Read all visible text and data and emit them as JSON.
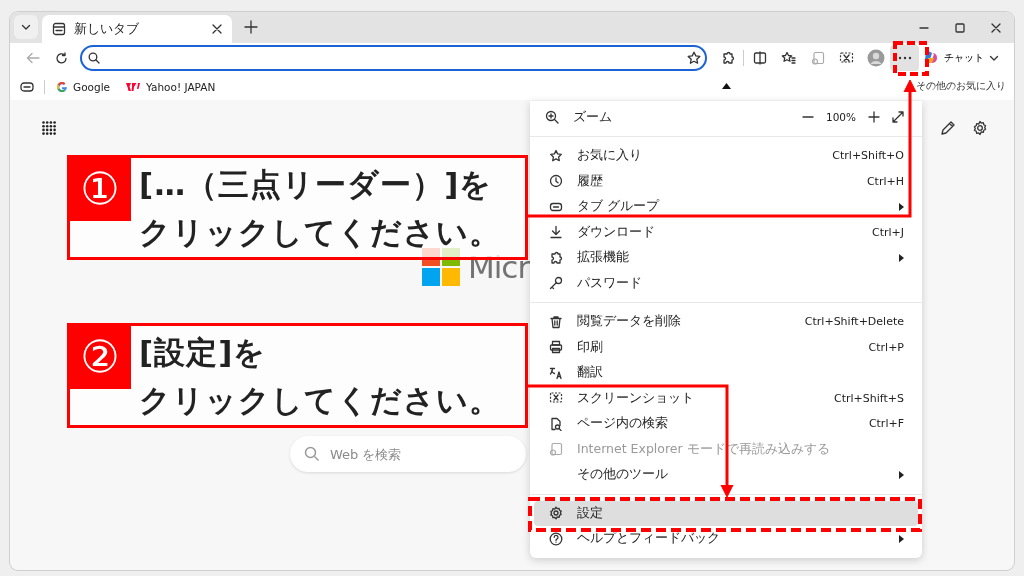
{
  "tab_strip": {
    "tabs": [
      {
        "title": "新しいタブ",
        "selected": true
      }
    ]
  },
  "toolbar": {
    "chat_label": "チャット"
  },
  "bookmarks_bar": {
    "items": [
      {
        "label": "Google",
        "kind": "google"
      },
      {
        "label": "Yahoo! JAPAN",
        "kind": "yahoo"
      }
    ],
    "other_favorites": "その他のお気に入り"
  },
  "new_tab_page": {
    "logo_text": "Micr",
    "search_placeholder": "Web を検索"
  },
  "menu": {
    "zoom": {
      "label": "ズーム",
      "value": "100%"
    },
    "sections": [
      {
        "items": [
          {
            "label": "お気に入り",
            "shortcut": "Ctrl+Shift+O",
            "submenu": false,
            "disabled": false,
            "selected": false
          },
          {
            "label": "履歴",
            "shortcut": "Ctrl+H",
            "submenu": false,
            "disabled": false,
            "selected": false
          },
          {
            "label": "タブ グループ",
            "submenu": true,
            "disabled": false,
            "selected": false
          },
          {
            "label": "ダウンロード",
            "shortcut": "Ctrl+J",
            "submenu": false,
            "disabled": false,
            "selected": false
          },
          {
            "label": "拡張機能",
            "submenu": true,
            "disabled": false,
            "selected": false
          },
          {
            "label": "パスワード",
            "submenu": false,
            "disabled": false,
            "selected": false
          }
        ]
      },
      {
        "items": [
          {
            "label": "閲覧データを削除",
            "shortcut": "Ctrl+Shift+Delete",
            "submenu": false,
            "disabled": false,
            "selected": false
          },
          {
            "label": "印刷",
            "shortcut": "Ctrl+P",
            "submenu": false,
            "disabled": false,
            "selected": false
          },
          {
            "label": "翻訳",
            "submenu": false,
            "disabled": false,
            "selected": false
          },
          {
            "label": "スクリーンショット",
            "shortcut": "Ctrl+Shift+S",
            "submenu": false,
            "disabled": false,
            "selected": false
          },
          {
            "label": "ページ内の検索",
            "shortcut": "Ctrl+F",
            "submenu": false,
            "disabled": false,
            "selected": false
          },
          {
            "label": "Internet Explorer モードで再読み込みする",
            "submenu": false,
            "disabled": true,
            "selected": false
          },
          {
            "label": "その他のツール",
            "submenu": true,
            "disabled": false,
            "selected": false
          }
        ]
      },
      {
        "items": [
          {
            "label": "設定",
            "submenu": false,
            "disabled": false,
            "selected": true
          },
          {
            "label": "ヘルプとフィードバック",
            "submenu": true,
            "disabled": false,
            "selected": false
          }
        ]
      }
    ]
  },
  "callouts": [
    {
      "number": "①",
      "lines": [
        "[…（三点リーダー）]を",
        "クリックしてください。"
      ]
    },
    {
      "number": "②",
      "lines": [
        "[設定]を",
        "クリックしてください。"
      ]
    }
  ]
}
